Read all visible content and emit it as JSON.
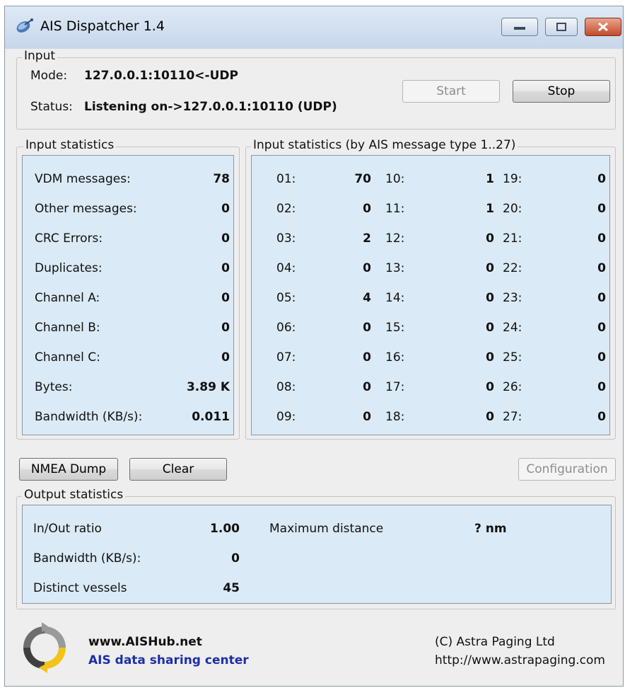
{
  "window": {
    "title": "AIS Dispatcher 1.4"
  },
  "input": {
    "legend": "Input",
    "mode_label": "Mode:",
    "mode_value": "127.0.0.1:10110<-UDP",
    "status_label": "Status:",
    "status_value": "Listening on->127.0.0.1:10110 (UDP)",
    "start_label": "Start",
    "stop_label": "Stop"
  },
  "input_stats": {
    "legend": "Input statistics",
    "rows": [
      {
        "label": "VDM messages:",
        "value": "78"
      },
      {
        "label": "Other messages:",
        "value": "0"
      },
      {
        "label": "CRC Errors:",
        "value": "0"
      },
      {
        "label": "Duplicates:",
        "value": "0"
      },
      {
        "label": "Channel A:",
        "value": "0"
      },
      {
        "label": "Channel B:",
        "value": "0"
      },
      {
        "label": "Channel C:",
        "value": "0"
      },
      {
        "label": "Bytes:",
        "value": "3.89 K"
      },
      {
        "label": "Bandwidth (KB/s):",
        "value": "0.011"
      }
    ]
  },
  "type_stats": {
    "legend": "Input statistics (by AIS message type 1..27)",
    "items": [
      {
        "label": "01:",
        "value": "70"
      },
      {
        "label": "02:",
        "value": "0"
      },
      {
        "label": "03:",
        "value": "2"
      },
      {
        "label": "04:",
        "value": "0"
      },
      {
        "label": "05:",
        "value": "4"
      },
      {
        "label": "06:",
        "value": "0"
      },
      {
        "label": "07:",
        "value": "0"
      },
      {
        "label": "08:",
        "value": "0"
      },
      {
        "label": "09:",
        "value": "0"
      },
      {
        "label": "10:",
        "value": "1"
      },
      {
        "label": "11:",
        "value": "1"
      },
      {
        "label": "12:",
        "value": "0"
      },
      {
        "label": "13:",
        "value": "0"
      },
      {
        "label": "14:",
        "value": "0"
      },
      {
        "label": "15:",
        "value": "0"
      },
      {
        "label": "16:",
        "value": "0"
      },
      {
        "label": "17:",
        "value": "0"
      },
      {
        "label": "18:",
        "value": "0"
      },
      {
        "label": "19:",
        "value": "0"
      },
      {
        "label": "20:",
        "value": "0"
      },
      {
        "label": "21:",
        "value": "0"
      },
      {
        "label": "22:",
        "value": "0"
      },
      {
        "label": "23:",
        "value": "0"
      },
      {
        "label": "24:",
        "value": "0"
      },
      {
        "label": "25:",
        "value": "0"
      },
      {
        "label": "26:",
        "value": "0"
      },
      {
        "label": "27:",
        "value": "0"
      }
    ]
  },
  "buttons": {
    "nmea_dump": "NMEA Dump",
    "clear": "Clear",
    "configuration": "Configuration"
  },
  "output_stats": {
    "legend": "Output statistics",
    "inout_label": "In/Out ratio",
    "inout_value": "1.00",
    "bandwidth_label": "Bandwidth (KB/s):",
    "bandwidth_value": "0",
    "vessels_label": "Distinct vessels",
    "vessels_value": "45",
    "maxdist_label": "Maximum distance",
    "maxdist_value": "? nm"
  },
  "footer": {
    "site": "www.AISHub.net",
    "tagline": "AIS data sharing center",
    "copyright": "(C) Astra Paging Ltd",
    "url": "http://www.astrapaging.com"
  },
  "colors": {
    "panel_bg": "#daeaf6",
    "tagline": "#1c2fa6"
  }
}
